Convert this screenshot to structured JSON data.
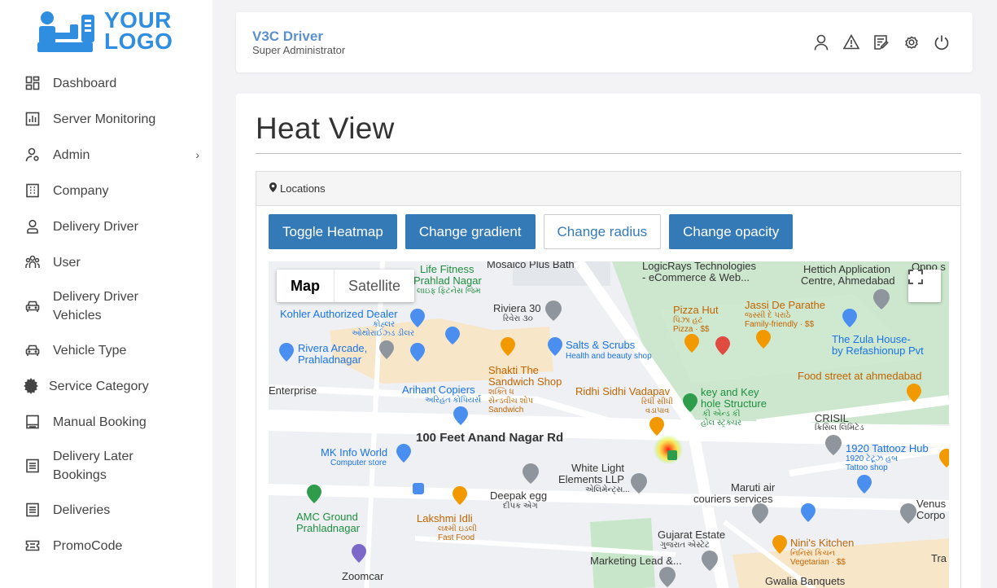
{
  "logo": {
    "line1": "YOUR",
    "line2": "LOGO"
  },
  "sidebar": {
    "items": [
      {
        "label": "Dashboard",
        "icon": "dashboard-icon"
      },
      {
        "label": "Server Monitoring",
        "icon": "bar-chart-icon"
      },
      {
        "label": "Admin",
        "icon": "admin-user-icon"
      },
      {
        "label": "Company",
        "icon": "building-icon"
      },
      {
        "label": "Delivery Driver",
        "icon": "driver-icon"
      },
      {
        "label": "User",
        "icon": "users-icon"
      },
      {
        "label": "Delivery Driver Vehicles",
        "icon": "car-icon"
      },
      {
        "label": "Vehicle Type",
        "icon": "car-icon"
      },
      {
        "label": "Service Category",
        "icon": "gear-icon"
      },
      {
        "label": "Manual Booking",
        "icon": "booking-icon"
      },
      {
        "label": "Delivery Later Bookings",
        "icon": "list-icon"
      },
      {
        "label": "Deliveries",
        "icon": "list-icon"
      },
      {
        "label": "PromoCode",
        "icon": "ticket-icon"
      }
    ],
    "admin_chevron": "›"
  },
  "topbar": {
    "title": "V3C Driver",
    "subtitle": "Super Administrator",
    "icons": [
      "user-icon",
      "warning-icon",
      "edit-note-icon",
      "settings-icon",
      "power-icon"
    ]
  },
  "main": {
    "title": "Heat View",
    "card_title": "Locations",
    "buttons": {
      "toggle_heatmap": "Toggle Heatmap",
      "change_gradient": "Change gradient",
      "change_radius": "Change radius",
      "change_opacity": "Change opacity"
    }
  },
  "map": {
    "type_map": "Map",
    "type_satellite": "Satellite",
    "labels": {
      "life_fitness": "Life Fitness",
      "prahlad_nagar": "Prahlad Nagar",
      "life_fitness_gu": "લાઇફ ફિટનેસ જિમ",
      "mosaico": "Mosaico Plus Bath",
      "logicrays1": "LogicRays Technologies",
      "logicrays2": "- eCommerce & Web...",
      "hettich1": "Hettich Application",
      "hettich2": "Centre, Ahmedabad",
      "oppo": "Oppo s",
      "kohler": "Kohler Authorized Dealer",
      "kohler_gu": "કોહ્લર",
      "kohler_gu2": "ઓથોરાઈઝ્ડ ડીલર",
      "riviera": "Riviera 30",
      "riviera_gu": "રિવેરા ૩૦",
      "pizza_hut": "Pizza Hut",
      "pizza_hut_gu": "પિઝા હટ",
      "pizza_hut_sub": "Pizza · $$",
      "jassi": "Jassi De Parathe",
      "jassi_gu": "જસ્સી દે પરાઠે",
      "jassi_sub": "Family-friendly · $$",
      "rivera_arcade1": "Rivera Arcade,",
      "rivera_arcade2": "Prahladnagar",
      "salts": "Salts & Scrubs",
      "salts_sub": "Health and beauty shop",
      "zula1": "The Zula House-",
      "zula2": "by Refashionup Pvt",
      "shakti1": "Shakti The",
      "shakti2": "Sandwich Shop",
      "shakti_gu1": "શક્તિ ધ",
      "shakti_gu2": "સેન્ડવીચ શોપ",
      "shakti_sub": "Sandwich",
      "food_street": "Food street at ahmedabad",
      "enterprise": "Enterprise",
      "arihant": "Arihant Copiers",
      "arihant_gu": "અરિહંત કોપિયર્સ",
      "ridhi": "Ridhi Sidhi Vadapav",
      "ridhi_gu1": "રિધી સીધી",
      "ridhi_gu2": "વડાપાવ",
      "keykey1": "key and Key",
      "keykey2": "hole Structure",
      "keykey_gu1": "કી એન્ડ કી",
      "keykey_gu2": "હોલ સ્ટ્રક્ચર",
      "crisil": "CRISIL",
      "crisil_gu": "ક્રિસિલ લિમિટેડ",
      "road": "100 Feet Anand Nagar Rd",
      "mk_info": "MK Info World",
      "mk_info_sub": "Computer store",
      "tattooz": "1920 Tattooz Hub",
      "tattooz_gu": "1920 ટેટૂઝ હબ",
      "tattooz_sub": "Tattoo shop",
      "white_light1": "White Light",
      "white_light2": "Elements LLP",
      "white_light_gu": "એલિમેન્ટ્સ...",
      "deepak": "Deepak egg",
      "deepak_gu": "દીપક એગ",
      "maruti1": "Maruti air",
      "maruti2": "couriers services",
      "venus1": "Venus",
      "venus2": "Corpo",
      "amc1": "AMC Ground",
      "amc2": "Prahladnagar",
      "lakshmi": "Lakshmi Idli",
      "lakshmi_gu": "લક્ષ્મી ઇડલી",
      "lakshmi_sub": "Fast Food",
      "gujarat_estate": "Gujarat Estate",
      "gujarat_estate_gu": "ગુજરાત એસ્ટેટ",
      "ninis": "Nini's Kitchen",
      "ninis_gu": "નિનિસ કિચન",
      "ninis_sub": "Vegetarian · $$",
      "marketing": "Marketing Lead &...",
      "gwalia": "Gwalia Banquets",
      "zoomcar": "Zoomcar",
      "tra": "Tra"
    }
  }
}
